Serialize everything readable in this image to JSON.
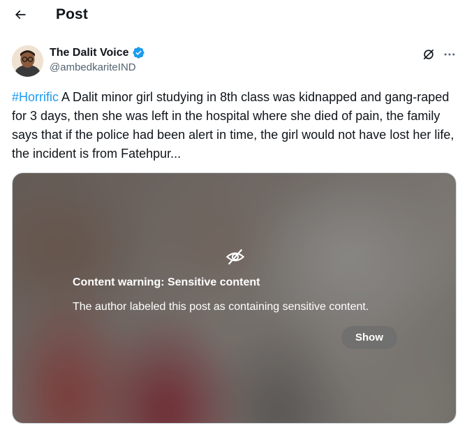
{
  "header": {
    "back_icon": "arrow-left-icon",
    "title": "Post"
  },
  "post": {
    "author": {
      "display_name": "The Dalit Voice",
      "handle": "@ambedkariteIND",
      "verified_icon": "verified-badge-icon",
      "verified_color": "#1d9bf0"
    },
    "actions": {
      "grok_icon": "grok-icon",
      "more_icon": "more-options-icon"
    },
    "hashtag": "#Horrific",
    "text": " A Dalit minor girl studying in 8th class was kidnapped and gang-raped for 3 days, then she was left in the hospital where she died of pain, the family says that if the police had been alert in time, the girl would not have lost her life, the incident is from Fatehpur...",
    "media_warning": {
      "icon": "eye-slash-icon",
      "title": "Content warning: Sensitive content",
      "description": "The author labeled this post as containing sensitive content.",
      "show_label": "Show"
    }
  },
  "colors": {
    "link": "#1d9bf0",
    "text": "#0f1419",
    "secondary_text": "#536471"
  }
}
